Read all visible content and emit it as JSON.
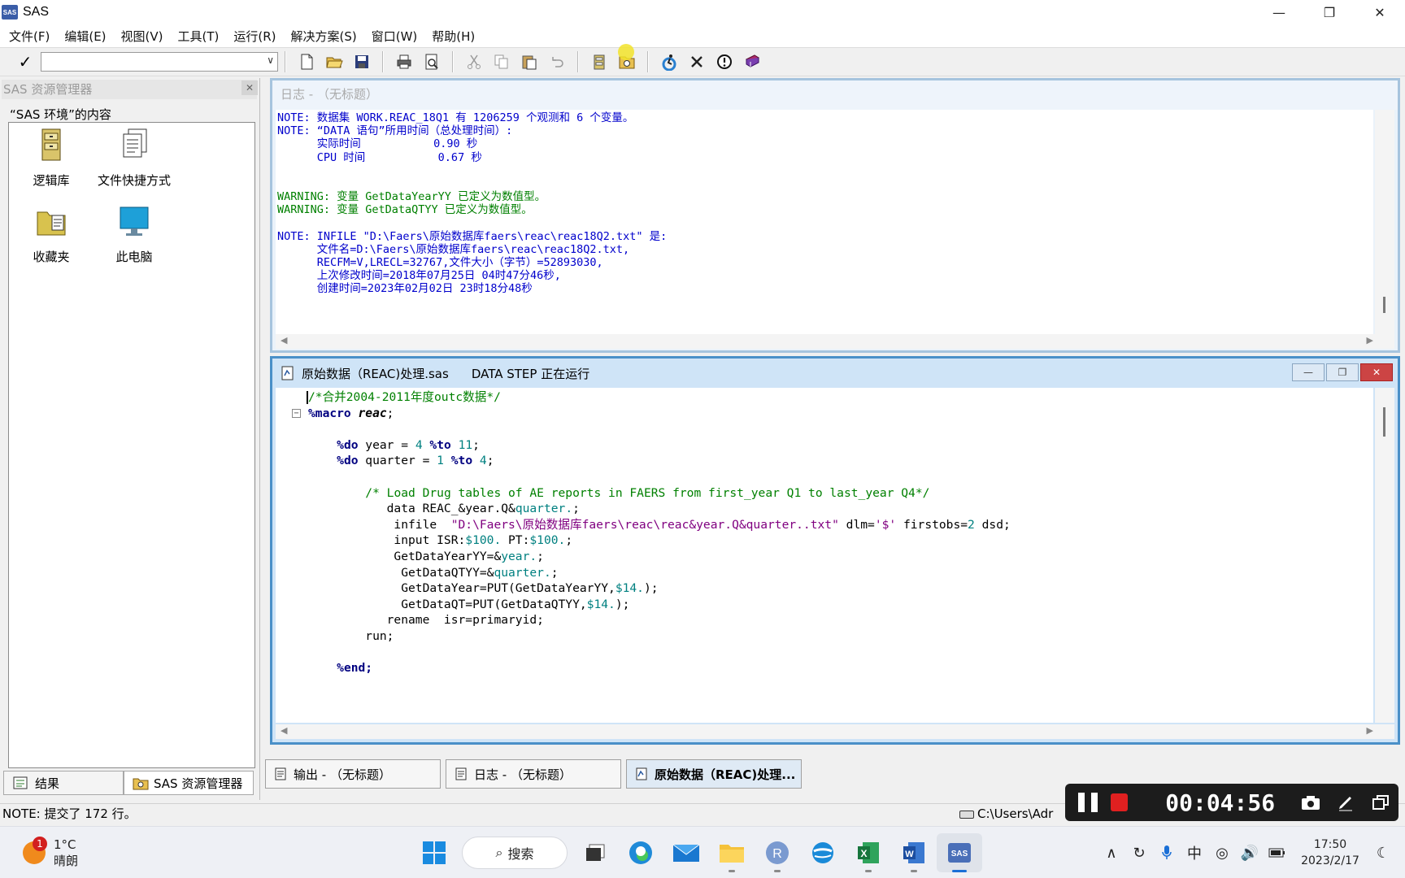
{
  "window": {
    "title": "SAS",
    "app_icon_text": "SAS"
  },
  "menu": [
    "文件(F)",
    "编辑(E)",
    "视图(V)",
    "工具(T)",
    "运行(R)",
    "解决方案(S)",
    "窗口(W)",
    "帮助(H)"
  ],
  "explorer": {
    "title": "SAS 资源管理器",
    "content_label": "“SAS 环境”的内容",
    "items": [
      {
        "label": "逻辑库",
        "icon": "library-cabinet-icon"
      },
      {
        "label": "文件快捷方式",
        "icon": "file-shortcuts-icon"
      },
      {
        "label": "收藏夹",
        "icon": "favorites-folder-icon"
      },
      {
        "label": "此电脑",
        "icon": "computer-monitor-icon"
      }
    ],
    "tabs": [
      {
        "label": "结果",
        "icon": "results-icon"
      },
      {
        "label": "SAS 资源管理器",
        "icon": "explorer-icon"
      }
    ]
  },
  "log_window": {
    "title": "日志 - （无标题）",
    "lines": [
      {
        "text": "NOTE: 数据集 WORK.REAC_18Q1 有 1206259 个观测和 6 个变量。",
        "color": "blue"
      },
      {
        "text": "NOTE: “DATA 语句”所用时间（总处理时间）:",
        "color": "blue"
      },
      {
        "text": "      实际时间           0.90 秒",
        "color": "blue"
      },
      {
        "text": "      CPU 时间           0.67 秒",
        "color": "blue"
      },
      {
        "text": "",
        "color": "blue"
      },
      {
        "text": "",
        "color": "blue"
      },
      {
        "text": "WARNING: 变量 GetDataYearYY 已定义为数值型。",
        "color": "green"
      },
      {
        "text": "WARNING: 变量 GetDataQTYY 已定义为数值型。",
        "color": "green"
      },
      {
        "text": "",
        "color": "blue"
      },
      {
        "text": "NOTE: INFILE \"D:\\Faers\\原始数据库faers\\reac\\reac18Q2.txt\" 是:",
        "color": "blue"
      },
      {
        "text": "      文件名=D:\\Faers\\原始数据库faers\\reac\\reac18Q2.txt,",
        "color": "blue"
      },
      {
        "text": "      RECFM=V,LRECL=32767,文件大小（字节）=52893030,",
        "color": "blue"
      },
      {
        "text": "      上次修改时间=2018年07月25日 04时47分46秒,",
        "color": "blue"
      },
      {
        "text": "      创建时间=2023年02月02日 23时18分48秒",
        "color": "blue"
      }
    ]
  },
  "editor_window": {
    "title": "原始数据（REAC)处理.sas",
    "status": "DATA STEP 正在运行",
    "lines": [
      [
        {
          "t": "/*合并2004-2011年度outc数据*/",
          "c": "green"
        }
      ],
      [
        {
          "t": "%macro",
          "c": "navy"
        },
        {
          "t": " "
        },
        {
          "t": "reac",
          "c": "italic"
        },
        {
          "t": ";"
        }
      ],
      [],
      [
        {
          "t": "    "
        },
        {
          "t": "%do",
          "c": "navy"
        },
        {
          "t": " year = "
        },
        {
          "t": "4",
          "c": "teal"
        },
        {
          "t": " "
        },
        {
          "t": "%to",
          "c": "navy"
        },
        {
          "t": " "
        },
        {
          "t": "11",
          "c": "teal"
        },
        {
          "t": ";"
        }
      ],
      [
        {
          "t": "    "
        },
        {
          "t": "%do",
          "c": "navy"
        },
        {
          "t": " quarter = "
        },
        {
          "t": "1",
          "c": "teal"
        },
        {
          "t": " "
        },
        {
          "t": "%to",
          "c": "navy"
        },
        {
          "t": " "
        },
        {
          "t": "4",
          "c": "teal"
        },
        {
          "t": ";"
        }
      ],
      [],
      [
        {
          "t": "        "
        },
        {
          "t": "/* Load Drug tables of AE reports in FAERS from first_year Q1 to last_year Q4*/",
          "c": "green"
        }
      ],
      [
        {
          "t": "           data REAC_&year.Q&"
        },
        {
          "t": "quarter.",
          "c": "teal"
        },
        {
          "t": ";"
        }
      ],
      [
        {
          "t": "            infile  "
        },
        {
          "t": "\"D:\\Faers\\原始数据库faers\\reac\\reac&year.Q&quarter..txt\"",
          "c": "purple"
        },
        {
          "t": " dlm="
        },
        {
          "t": "'$'",
          "c": "purple"
        },
        {
          "t": " firstobs="
        },
        {
          "t": "2",
          "c": "teal"
        },
        {
          "t": " dsd;"
        }
      ],
      [
        {
          "t": "            input ISR:"
        },
        {
          "t": "$100.",
          "c": "teal"
        },
        {
          "t": " PT:"
        },
        {
          "t": "$100.",
          "c": "teal"
        },
        {
          "t": ";"
        }
      ],
      [
        {
          "t": "            GetDataYearYY=&"
        },
        {
          "t": "year.",
          "c": "teal"
        },
        {
          "t": ";"
        }
      ],
      [
        {
          "t": "             GetDataQTYY=&"
        },
        {
          "t": "quarter.",
          "c": "teal"
        },
        {
          "t": ";"
        }
      ],
      [
        {
          "t": "             GetDataYear=PUT(GetDataYearYY,"
        },
        {
          "t": "$14.",
          "c": "teal"
        },
        {
          "t": ");"
        }
      ],
      [
        {
          "t": "             GetDataQT=PUT(GetDataQTYY,"
        },
        {
          "t": "$14.",
          "c": "teal"
        },
        {
          "t": ");"
        }
      ],
      [
        {
          "t": "           rename  isr=primaryid;"
        }
      ],
      [
        {
          "t": "        run;"
        }
      ],
      [],
      [
        {
          "t": "    "
        },
        {
          "t": "%end;",
          "c": "navy"
        }
      ]
    ]
  },
  "window_tabs": [
    {
      "label": "输出 - （无标题）",
      "active": false
    },
    {
      "label": "日志 - （无标题）",
      "active": false
    },
    {
      "label": "原始数据（REAC)处理...",
      "active": true
    }
  ],
  "status": {
    "message": "NOTE: 提交了 172 行。",
    "path": "C:\\Users\\Adr"
  },
  "recorder": {
    "time": "00:04:56"
  },
  "taskbar": {
    "weather_temp": "1°C",
    "weather_desc": "晴朗",
    "weather_badge": "1",
    "search_label": "搜索",
    "tray_lang": "中",
    "time": "17:50",
    "date": "2023/2/17"
  }
}
